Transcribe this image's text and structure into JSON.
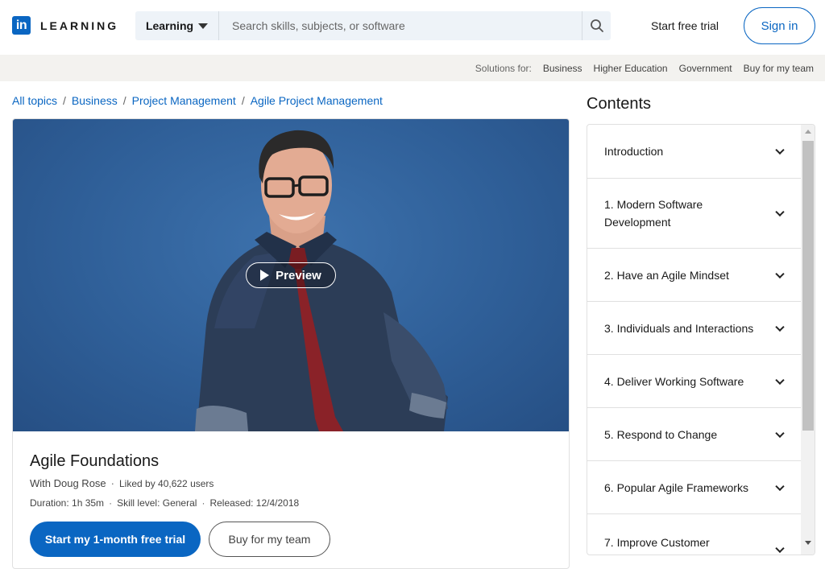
{
  "header": {
    "logo_text": "LEARNING",
    "search_dropdown": "Learning",
    "search_placeholder": "Search skills, subjects, or software",
    "start_trial": "Start free trial",
    "sign_in": "Sign in"
  },
  "subnav": {
    "label": "Solutions for:",
    "items": [
      "Business",
      "Higher Education",
      "Government",
      "Buy for my team"
    ]
  },
  "breadcrumb": [
    "All topics",
    "Business",
    "Project Management",
    "Agile Project Management"
  ],
  "course": {
    "preview_label": "Preview",
    "title": "Agile Foundations",
    "author": "With Doug Rose",
    "likes": "Liked by 40,622 users",
    "duration": "Duration: 1h 35m",
    "skill": "Skill level: General",
    "released": "Released: 12/4/2018",
    "primary_cta": "Start my 1-month free trial",
    "secondary_cta": "Buy for my team"
  },
  "contents": {
    "title": "Contents",
    "chapters": [
      "Introduction",
      "1. Modern Software Development",
      "2. Have an Agile Mindset",
      "3. Individuals and Interactions",
      "4. Deliver Working Software",
      "5. Respond to Change",
      "6. Popular Agile Frameworks",
      "7. Improve Customer"
    ]
  },
  "colors": {
    "brand": "#0a66c2",
    "hero_background": "#2f5f98"
  }
}
